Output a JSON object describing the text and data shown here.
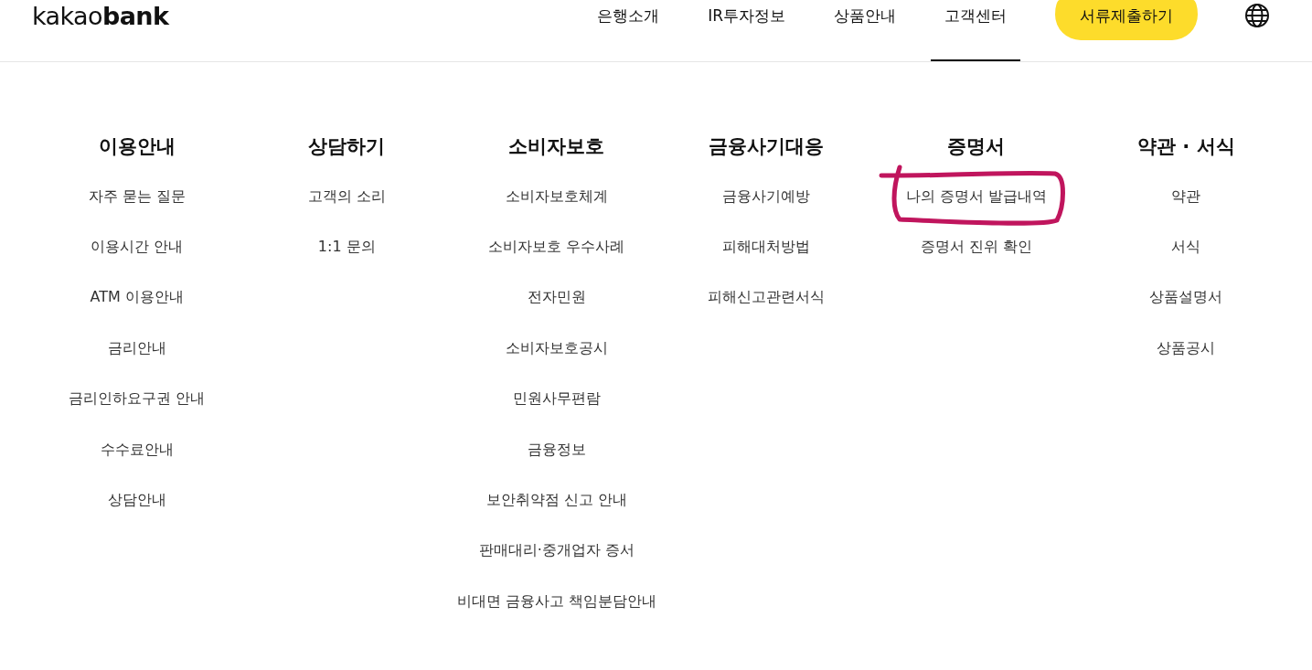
{
  "header": {
    "logo": "kakao**bank**",
    "tabs": [
      {
        "label": "은행소개",
        "selected": false
      },
      {
        "label": "IR투자정보",
        "selected": false
      },
      {
        "label": "상품안내",
        "selected": false
      },
      {
        "label": "고객센터",
        "selected": true
      }
    ],
    "submit_button": "서류제출하기"
  },
  "menu": {
    "columns": [
      {
        "heading": "이용안내",
        "items": [
          {
            "label": "자주 묻는 질문",
            "circled": false
          },
          {
            "label": "이용시간 안내",
            "circled": false
          },
          {
            "label": "ATM 이용안내",
            "circled": false
          },
          {
            "label": "금리안내",
            "circled": false
          },
          {
            "label": "금리인하요구권 안내",
            "circled": false
          },
          {
            "label": "수수료안내",
            "circled": false
          },
          {
            "label": "상담안내",
            "circled": false
          }
        ]
      },
      {
        "heading": "상담하기",
        "items": [
          {
            "label": "고객의 소리",
            "circled": false
          },
          {
            "label": "1:1 문의",
            "circled": false
          }
        ]
      },
      {
        "heading": "소비자보호",
        "items": [
          {
            "label": "소비자보호체계",
            "circled": false
          },
          {
            "label": "소비자보호 우수사례",
            "circled": false
          },
          {
            "label": "전자민원",
            "circled": false
          },
          {
            "label": "소비자보호공시",
            "circled": false
          },
          {
            "label": "민원사무편람",
            "circled": false
          },
          {
            "label": "금융정보",
            "circled": false
          },
          {
            "label": "보안취약점 신고 안내",
            "circled": false
          },
          {
            "label": "판매대리·중개업자 증서",
            "circled": false
          },
          {
            "label": "비대면 금융사고 책임분담안내",
            "circled": false
          }
        ]
      },
      {
        "heading": "금융사기대응",
        "items": [
          {
            "label": "금융사기예방",
            "circled": false
          },
          {
            "label": "피해대처방법",
            "circled": false
          },
          {
            "label": "피해신고관련서식",
            "circled": false
          }
        ]
      },
      {
        "heading": "증명서",
        "items": [
          {
            "label": "나의 증명서 발급내역",
            "circled": true
          },
          {
            "label": "증명서 진위 확인",
            "circled": false
          }
        ]
      },
      {
        "heading": "약관 · 서식",
        "items": [
          {
            "label": "약관",
            "circled": false
          },
          {
            "label": "서식",
            "circled": false
          },
          {
            "label": "상품설명서",
            "circled": false
          },
          {
            "label": "상품공시",
            "circled": false
          }
        ]
      }
    ]
  }
}
